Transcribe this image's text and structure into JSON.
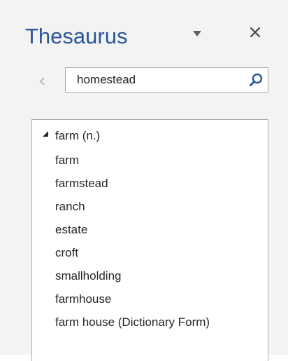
{
  "pane": {
    "title": "Thesaurus",
    "options_icon": "caret-down-icon",
    "close_icon": "close-icon",
    "accent_color": "#2b579a"
  },
  "search": {
    "value": "homestead",
    "back_icon": "chevron-left-icon",
    "search_icon": "magnifier-icon"
  },
  "results": {
    "group_label": "farm (n.)",
    "expand_icon": "triangle-expanded-icon",
    "items": [
      "farm",
      "farmstead",
      "ranch",
      "estate",
      "croft",
      "smallholding",
      "farmhouse",
      "farm house (Dictionary Form)"
    ]
  }
}
